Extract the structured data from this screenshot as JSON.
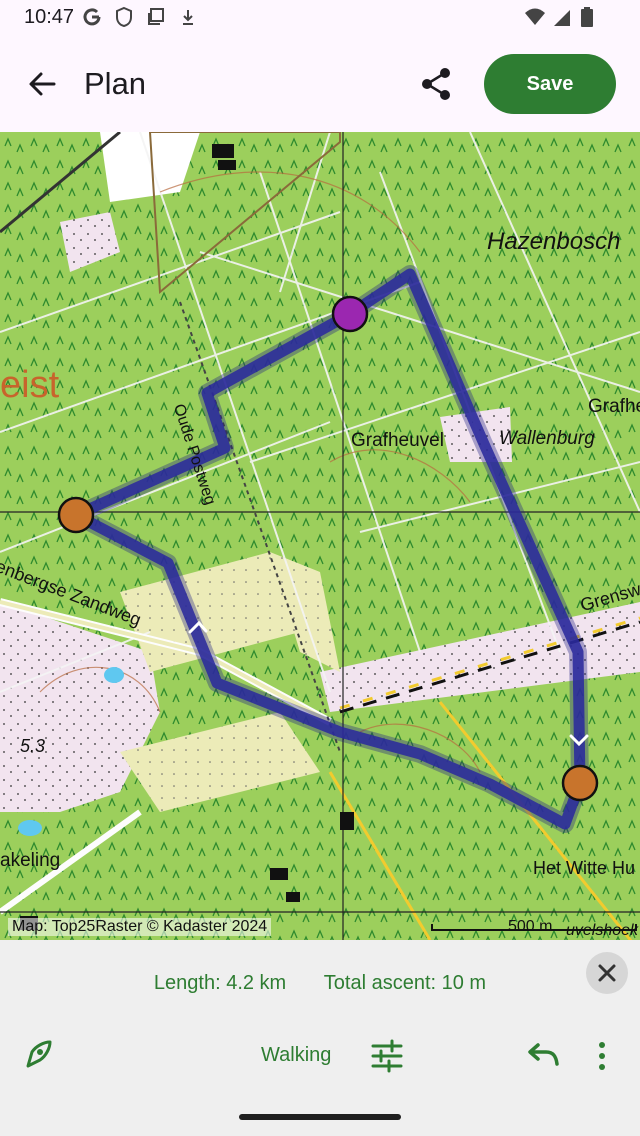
{
  "status_bar": {
    "time": "10:47",
    "icons_left": [
      "google-icon",
      "shield-icon",
      "screenshot-icon",
      "download-icon"
    ],
    "icons_right": [
      "wifi-icon",
      "signal-icon",
      "battery-icon"
    ]
  },
  "app_bar": {
    "title": "Plan",
    "save_label": "Save"
  },
  "map": {
    "labels": {
      "hazenbosch": "Hazenbosch",
      "zeist": "eist",
      "grafhe": "Grafhe",
      "grafheuvel": "Grafheuvel",
      "wallenburg": "Wallenburg",
      "oude_postweg": "Oude Postweg",
      "zandweg": "enbergse Zandweg",
      "grensw": "Grensw",
      "elevation": "5.3",
      "akeling": "akeling",
      "witte_huis": "Het Witte Hu",
      "uvelshoek": "uvelshoek"
    },
    "attribution": "Map: Top25Raster © Kadaster 2024",
    "scale": "500 m",
    "route_color": "#2b2a9c",
    "waypoint_color": "#c8742c",
    "active_waypoint_color": "#9b27b0"
  },
  "bottom_panel": {
    "length": "Length: 4.2 km",
    "ascent": "Total ascent: 10 m",
    "mode": "Walking"
  },
  "colors": {
    "accent": "#2e7d32",
    "background": "#fef7ff",
    "panel": "#efefef"
  }
}
